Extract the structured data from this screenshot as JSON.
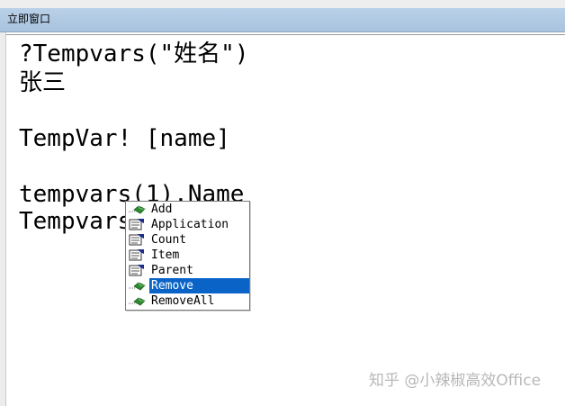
{
  "window": {
    "title": "立即窗口"
  },
  "editor": {
    "lines": [
      "?Tempvars(\"姓名\")",
      "张三",
      "",
      "TempVar! [name]",
      "",
      "tempvars(1).Name",
      "Tempvars.R"
    ]
  },
  "autocomplete": {
    "selected": "Remove",
    "items": [
      {
        "label": "Add",
        "icon": "method-icon"
      },
      {
        "label": "Application",
        "icon": "property-icon"
      },
      {
        "label": "Count",
        "icon": "property-icon"
      },
      {
        "label": "Item",
        "icon": "property-icon"
      },
      {
        "label": "Parent",
        "icon": "property-icon"
      },
      {
        "label": "Remove",
        "icon": "method-icon"
      },
      {
        "label": "RemoveAll",
        "icon": "method-icon"
      }
    ]
  },
  "watermark": {
    "text": "知乎 @小辣椒高效Office"
  },
  "colors": {
    "titlebar": "#b4cbe5",
    "selection": "#0a64c8",
    "method_icon": "#2e8b2e",
    "property_icon": "#1c2f8c"
  }
}
